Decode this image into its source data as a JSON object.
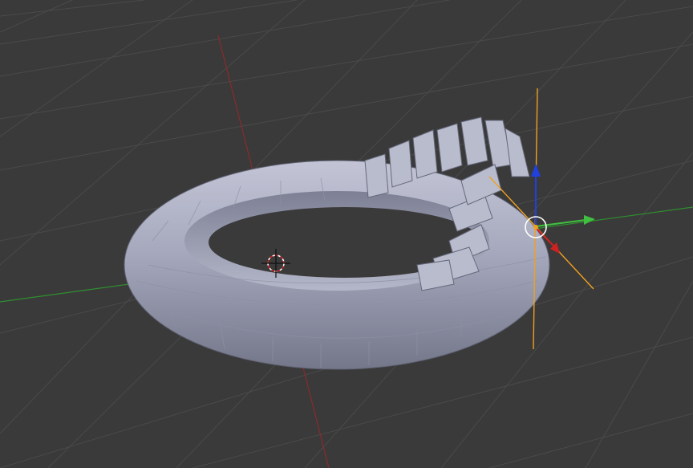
{
  "viewport": {
    "background": "#3a3a3a",
    "grid_color": "#4b4b4b",
    "x_axis_color": "#8a2b2b",
    "y_axis_color": "#2f8f2f"
  },
  "scene": {
    "object_type": "torus",
    "object_color": "#a9acc1",
    "object_shadow": "#6c6f82",
    "selection_outline": "#f0a020"
  },
  "gizmo": {
    "x_arrow_color": "#d02020",
    "y_arrow_color": "#40c040",
    "z_arrow_color": "#2040e0",
    "widget_icon": "manipulator-circle-icon"
  },
  "cursor": {
    "icon": "3d-cursor-icon"
  }
}
